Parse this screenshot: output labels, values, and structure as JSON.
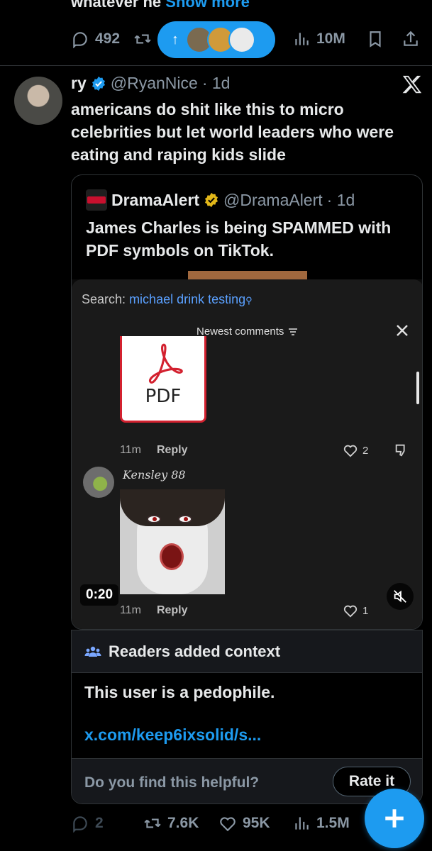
{
  "previous_tweet": {
    "text_fragment": "whatever he",
    "show_more": "Show more",
    "replies": "492",
    "views": "10M"
  },
  "new_posts_pill": {
    "arrow": "↑"
  },
  "tweet": {
    "display_name": "ry",
    "handle": "@RyanNice",
    "time": "· 1d",
    "text": "americans do shit like this to micro celebrities but let world leaders who were eating and raping kids slide"
  },
  "quote": {
    "display_name": "DramaAlert",
    "handle": "@DramaAlert",
    "time": "· 1d",
    "text": "James Charles is being SPAMMED with PDF symbols on TikTok."
  },
  "tiktok": {
    "search_label": "Search:",
    "search_query": "michael drink testing",
    "sort_label": "Newest comments",
    "pdf_label": "PDF",
    "comment1": {
      "time": "11m",
      "reply": "Reply",
      "likes": "2"
    },
    "comment2": {
      "username": "Kensley 88",
      "time": "11m",
      "reply": "Reply",
      "likes": "1"
    },
    "timecode": "0:20"
  },
  "note": {
    "title": "Readers added context",
    "body": "This user is a pedophile.",
    "link": "x.com/keep6ixsolid/s...",
    "question": "Do you find this helpful?",
    "rate_label": "Rate it"
  },
  "tweet_actions": {
    "replies": "2",
    "reposts": "7.6K",
    "likes": "95K",
    "views": "1.5M"
  },
  "colors": {
    "accent": "#1d9bf0",
    "background": "#000000",
    "muted": "#8b98a5",
    "border": "#2f3336"
  }
}
